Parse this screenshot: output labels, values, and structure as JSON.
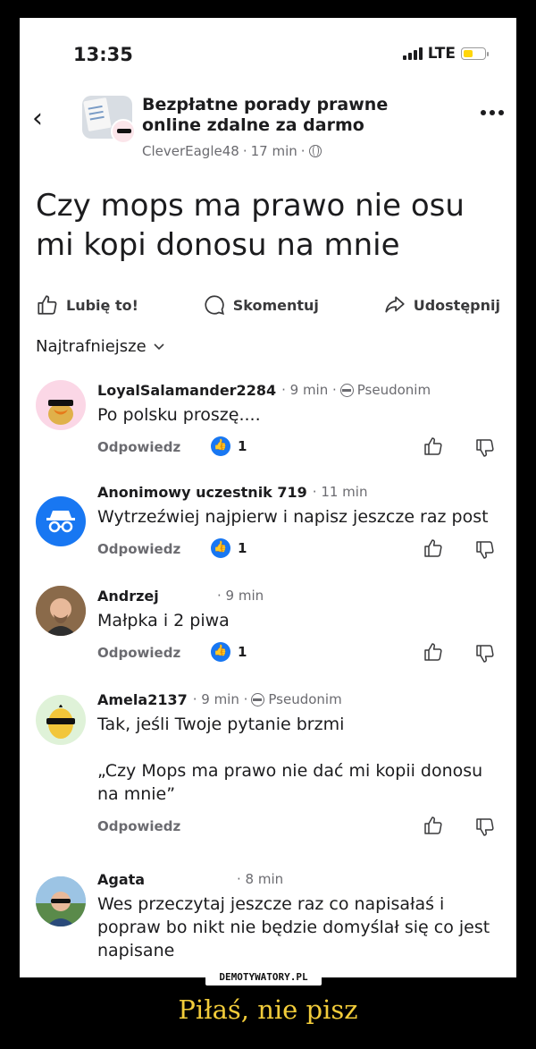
{
  "status_bar": {
    "time": "13:35",
    "network": "LTE"
  },
  "group": {
    "name": "Bezpłatne porady prawne online zdalne za darmo",
    "author": "CleverEagle48",
    "time": "17 min",
    "separator": "·"
  },
  "post": {
    "title": "Czy mops ma prawo nie osu mi kopi donosu na mnie"
  },
  "actions": {
    "like": "Lubię to!",
    "comment": "Skomentuj",
    "share": "Udostępnij"
  },
  "sort": {
    "label": "Najtrafniejsze"
  },
  "comments": [
    {
      "author": "LoyalSalamander2284",
      "meta": "· 9 min ·",
      "badge": "Pseudonim",
      "text": "Po polsku proszę....",
      "reply": "Odpowiedz",
      "likes": "1"
    },
    {
      "author": "Anonimowy uczestnik 719",
      "meta": "· 11 min",
      "badge": "",
      "text": "Wytrzeźwiej najpierw i napisz jeszcze raz post",
      "reply": "Odpowiedz",
      "likes": "1"
    },
    {
      "author": "Andrzej",
      "meta": "· 9 min",
      "badge": "",
      "text": "Małpka i 2 piwa",
      "reply": "Odpowiedz",
      "likes": "1"
    },
    {
      "author": "Amela2137",
      "meta": "· 9 min ·",
      "badge": "Pseudonim",
      "text_line1": "Tak, jeśli Twoje pytanie brzmi",
      "text_line2": "„Czy Mops ma prawo nie dać mi kopii donosu na mnie”",
      "reply": "Odpowiedz"
    },
    {
      "author": "Agata",
      "meta": "· 8 min",
      "badge": "",
      "text": "Wes przeczytaj jeszcze raz co napisałaś i popraw bo nikt nie będzie domyślał się co jest napisane"
    }
  ],
  "watermark": "DEMOTYWATORY.PL",
  "caption": "Piłaś, nie pisz",
  "colors": {
    "like_blue": "#1877f2",
    "caption_gold": "#f2cc3a",
    "anon_blue": "#1877f2"
  }
}
